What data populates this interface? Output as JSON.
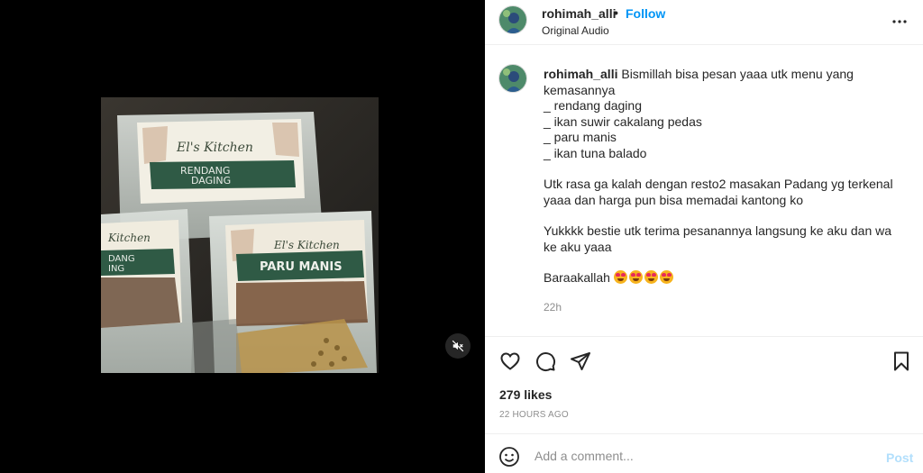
{
  "media": {
    "product_brand_1": "El's Kitchen",
    "product_label_1": "RENDANG DAGING",
    "product_brand_2": "El's Kitchen",
    "product_label_2": "PARU MANIS",
    "product_label_3": "RENDANG DAGING",
    "mute_icon": "speaker-muted-icon"
  },
  "header": {
    "username": "rohimah_alli",
    "separator": "•",
    "follow_label": "Follow",
    "audio_label": "Original Audio",
    "more_icon": "more-horizontal-icon"
  },
  "caption": {
    "username": "rohimah_alli",
    "paragraphs": [
      [
        "Bismillah bisa pesan yaaa utk menu yang kemasannya",
        "_ rendang daging",
        "_ ikan suwir cakalang pedas",
        "_ paru manis",
        "_ ikan tuna balado"
      ],
      [
        "Utk rasa ga kalah dengan resto2 masakan Padang yg terkenal yaaa dan harga pun bisa memadai kantong ko"
      ],
      [
        "Yukkkk bestie utk terima pesanannya langsung ke aku dan wa ke aku yaaa"
      ],
      [
        "Baraakallah"
      ]
    ],
    "emoji_name": "smiling-face-with-heart-eyes",
    "emoji_count": 4,
    "time_ago": "22h"
  },
  "actions": {
    "like_icon": "heart-icon",
    "comment_icon": "comment-icon",
    "share_icon": "paper-plane-icon",
    "save_icon": "bookmark-icon"
  },
  "stats": {
    "likes": "279 likes",
    "post_date": "22 HOURS AGO"
  },
  "comment": {
    "emoji_icon": "smiley-icon",
    "placeholder": "Add a comment...",
    "post_label": "Post"
  },
  "colors": {
    "follow_blue": "#0095f6",
    "post_disabled": "#b2dffc",
    "muted_text": "#8e8e8e"
  }
}
